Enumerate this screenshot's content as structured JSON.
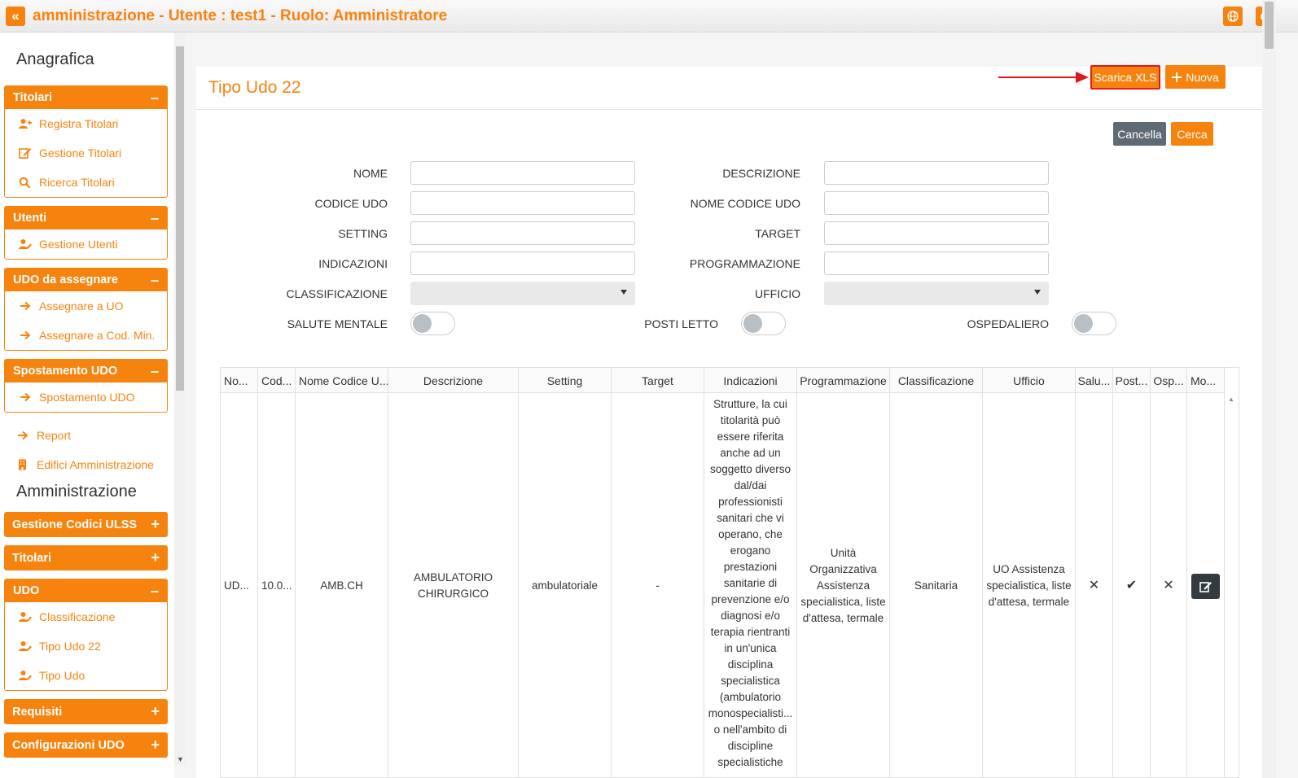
{
  "topbar": {
    "title": "amministrazione - Utente : test1 - Ruolo: Amministratore",
    "collapse_glyph": "«"
  },
  "sidebar": {
    "section1": "Anagrafica",
    "titolari": {
      "label": "Titolari",
      "toggle": "–",
      "items": [
        "Registra Titolari",
        "Gestione Titolari",
        "Ricerca Titolari"
      ]
    },
    "utenti": {
      "label": "Utenti",
      "toggle": "–",
      "items": [
        "Gestione Utenti"
      ]
    },
    "udo_assegnare": {
      "label": "UDO da assegnare",
      "toggle": "–",
      "items": [
        "Assegnare a UO",
        "Assegnare a Cod. Min."
      ]
    },
    "spostamento": {
      "label": "Spostamento UDO",
      "toggle": "–",
      "items": [
        "Spostamento UDO"
      ]
    },
    "links": [
      "Report",
      "Edifici Amministrazione"
    ],
    "section2": "Amministrazione",
    "codici_ulss": {
      "label": "Gestione Codici ULSS",
      "toggle": "+"
    },
    "titolari2": {
      "label": "Titolari",
      "toggle": "+"
    },
    "udo": {
      "label": "UDO",
      "toggle": "–",
      "items": [
        "Classificazione",
        "Tipo Udo 22",
        "Tipo Udo"
      ]
    },
    "requisiti": {
      "label": "Requisiti",
      "toggle": "+"
    },
    "config_udo": {
      "label": "Configurazioni UDO",
      "toggle": "+"
    }
  },
  "page": {
    "title": "Tipo Udo 22",
    "download_label": "Scarica XLS",
    "new_label": "Nuova",
    "cancel_label": "Cancella",
    "search_label": "Cerca"
  },
  "filters": {
    "nome": "NOME",
    "descrizione": "DESCRIZIONE",
    "codice_udo": "CODICE UDO",
    "nome_codice_udo": "NOME CODICE UDO",
    "setting": "SETTING",
    "target": "TARGET",
    "indicazioni": "INDICAZIONI",
    "programmazione": "PROGRAMMAZIONE",
    "classificazione": "CLASSIFICAZIONE",
    "ufficio": "UFFICIO",
    "salute_mentale": "SALUTE MENTALE",
    "posti_letto": "POSTI LETTO",
    "ospedaliero": "OSPEDALIERO"
  },
  "table": {
    "headers": [
      "No...",
      "Cod...",
      "Nome Codice U...",
      "Descrizione",
      "Setting",
      "Target",
      "Indicazioni",
      "Programmazione",
      "Classificazione",
      "Ufficio",
      "Salu...",
      "Post...",
      "Osp...",
      "Mo..."
    ],
    "row": {
      "nome": "UD...",
      "codice": "10.0...",
      "nome_codice": "AMB.CH",
      "descrizione": "AMBULATORIO CHIRURGICO",
      "setting": "ambulatoriale",
      "target": "-",
      "indicazioni": "Strutture, la cui titolarità può essere riferita anche ad un soggetto diverso dal/dai professionisti sanitari che vi operano, che erogano prestazioni sanitarie di prevenzione e/o diagnosi e/o terapia rientranti in un'unica disciplina specialistica (ambulatorio monospecialisti... o nell'ambito di discipline specialistiche",
      "programmazione": "Unità Organizzativa Assistenza specialistica, liste d'attesa, termale",
      "classificazione": "Sanitaria",
      "ufficio": "UO Assistenza specialistica, liste d'attesa, termale",
      "salute_mentale": "✕",
      "posti_letto": "✔",
      "ospedaliero": "✕"
    }
  },
  "icons": {
    "globe": "globe-icon",
    "power": "power-icon",
    "edit": "edit-icon"
  },
  "colors": {
    "accent": "#f7830f",
    "cancel": "#5f6b74",
    "highlight": "#e21b1b"
  }
}
